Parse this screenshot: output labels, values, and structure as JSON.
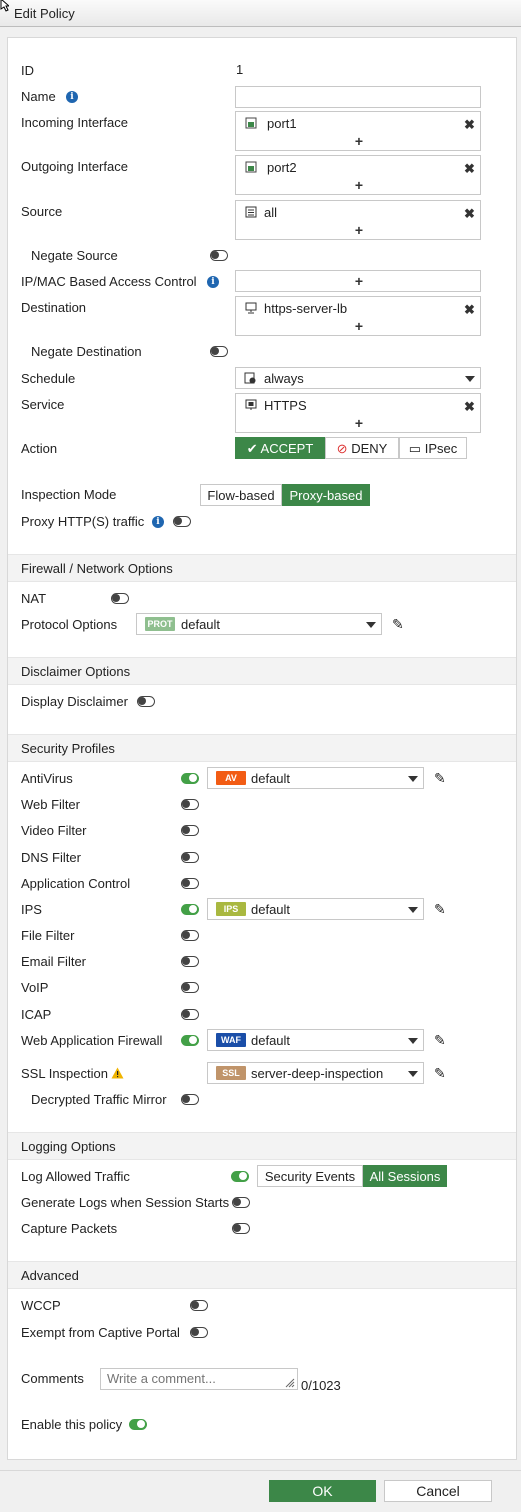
{
  "window": {
    "title": "Edit Policy"
  },
  "policy": {
    "id_label": "ID",
    "id_value": "1",
    "name_label": "Name",
    "name_value": "",
    "incoming_label": "Incoming Interface",
    "incoming_value": "port1",
    "outgoing_label": "Outgoing Interface",
    "outgoing_value": "port2",
    "source_label": "Source",
    "source_value": "all",
    "negate_source_label": "Negate Source",
    "ipmac_label": "IP/MAC Based Access Control",
    "destination_label": "Destination",
    "destination_value": "https-server-lb",
    "negate_destination_label": "Negate Destination",
    "schedule_label": "Schedule",
    "schedule_value": "always",
    "service_label": "Service",
    "service_value": "HTTPS",
    "action_label": "Action",
    "action_accept": "ACCEPT",
    "action_deny": "DENY",
    "action_ipsec": "IPsec",
    "inspection_label": "Inspection Mode",
    "inspection_flow": "Flow-based",
    "inspection_proxy": "Proxy-based",
    "proxy_http_label": "Proxy HTTP(S) traffic",
    "add_symbol": "+",
    "remove_symbol": "✖",
    "info_symbol": "i"
  },
  "firewall": {
    "section_title": "Firewall / Network Options",
    "nat_label": "NAT",
    "protocol_label": "Protocol Options",
    "protocol_badge": "PROT",
    "protocol_value": "default"
  },
  "disclaimer": {
    "section_title": "Disclaimer Options",
    "display_label": "Display Disclaimer"
  },
  "security": {
    "section_title": "Security Profiles",
    "antivirus_label": "AntiVirus",
    "av_badge": "AV",
    "av_value": "default",
    "webfilter_label": "Web Filter",
    "videofilter_label": "Video Filter",
    "dnsfilter_label": "DNS Filter",
    "appcontrol_label": "Application Control",
    "ips_label": "IPS",
    "ips_badge": "IPS",
    "ips_value": "default",
    "filefilter_label": "File Filter",
    "emailfilter_label": "Email Filter",
    "voip_label": "VoIP",
    "icap_label": "ICAP",
    "waf_label": "Web Application Firewall",
    "waf_badge": "WAF",
    "waf_value": "default",
    "ssl_label": "SSL Inspection",
    "ssl_badge": "SSL",
    "ssl_value": "server-deep-inspection",
    "decrypted_label": "Decrypted Traffic Mirror"
  },
  "logging": {
    "section_title": "Logging Options",
    "log_allowed_label": "Log Allowed Traffic",
    "opt_security": "Security Events",
    "opt_all": "All Sessions",
    "gen_logs_label": "Generate Logs when Session Starts",
    "capture_label": "Capture Packets"
  },
  "advanced": {
    "section_title": "Advanced",
    "wccp_label": "WCCP",
    "exempt_label": "Exempt from Captive Portal",
    "comments_label": "Comments",
    "comments_placeholder": "Write a comment...",
    "comments_count": "0/1023",
    "enable_label": "Enable this policy"
  },
  "footer": {
    "ok": "OK",
    "cancel": "Cancel"
  },
  "colors": {
    "accent_green": "#3c8748",
    "toggle_on": "#43a047",
    "av": "#f25c14",
    "ips": "#a9b840",
    "waf": "#1a4ea8",
    "ssl": "#c0946a",
    "prot": "#8fbf8f",
    "info": "#1f66b0",
    "warning": "#f0b400"
  }
}
